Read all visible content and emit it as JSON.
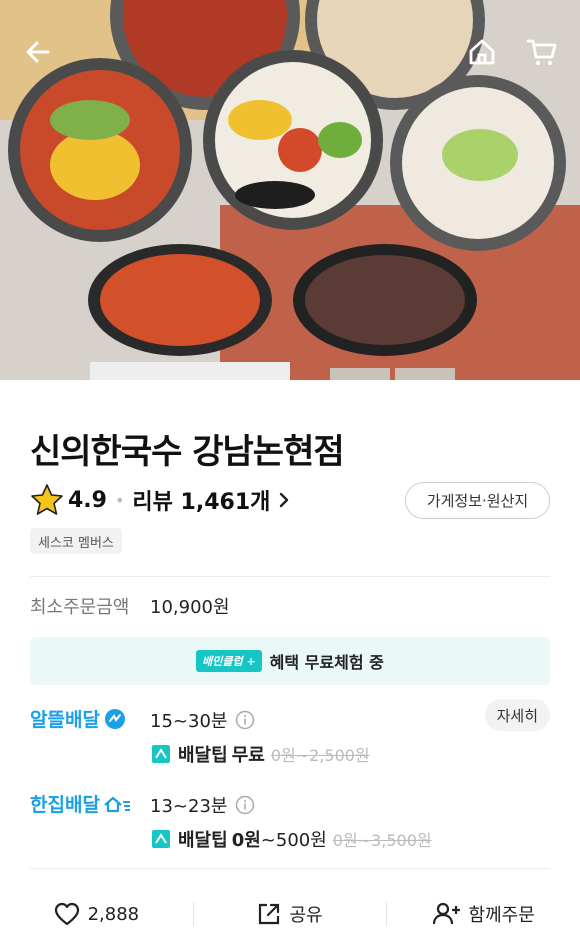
{
  "store": {
    "name": "신의한국수 강남논현점",
    "rating": "4.9",
    "review_label": "리뷰 1,461개",
    "info_button": "가게정보·원산지",
    "member_badge": "세스코 멤버스"
  },
  "min_order": {
    "label": "최소주문금액",
    "value": "10,900원"
  },
  "promo": {
    "club_label": "배민클럽",
    "text": "혜택 무료체험 중"
  },
  "delivery_economy": {
    "name": "알뜰배달",
    "time": "15~30분",
    "detail_button": "자세히",
    "tip_label": "배달팁",
    "tip_value": "무료",
    "tip_original": "0원~2,500원"
  },
  "delivery_single": {
    "name": "한집배달",
    "time": "13~23분",
    "tip_label": "배달팁",
    "tip_value": "0원",
    "tip_range": "~500원",
    "tip_original": "0원~3,500원"
  },
  "bottom_bar": {
    "likes": "2,888",
    "share": "공유",
    "group_order": "함께주문"
  },
  "colors": {
    "brand_teal": "#18c5c5",
    "delivery_blue": "#1ba0e8",
    "tip_icon": "#18c5c5",
    "star": "#f5c518"
  },
  "icons": [
    "back-arrow-icon",
    "home-icon",
    "cart-icon",
    "star-icon",
    "chevron-right-icon",
    "info-icon",
    "delivery-tip-icon",
    "heart-icon",
    "share-icon",
    "add-person-icon"
  ]
}
